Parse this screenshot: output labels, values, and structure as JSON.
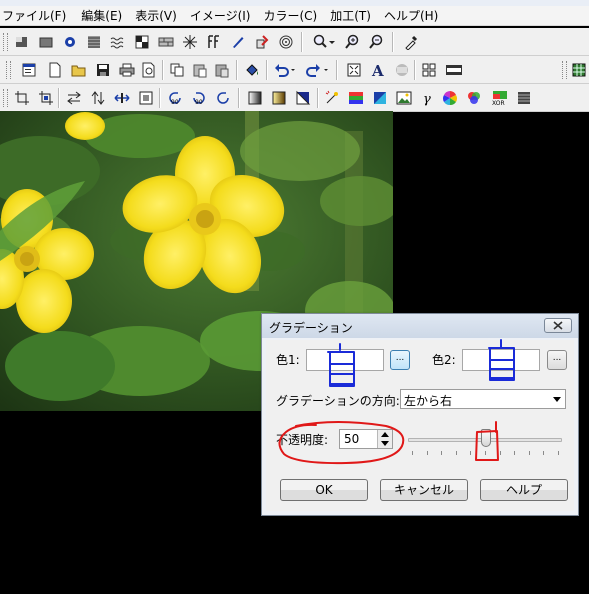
{
  "menu": [
    "ファイル(F)",
    "編集(E)",
    "表示(V)",
    "イメージ(I)",
    "カラー(C)",
    "加工(T)",
    "ヘルプ(H)"
  ],
  "toolbar_icons": {
    "row1": [
      "select-rect-icon",
      "flat-rect-icon",
      "starburst-icon",
      "dither-icon",
      "wave-icon",
      "contrast-icon",
      "brick-icon",
      "explode-icon",
      "ff-icon",
      "pen-icon",
      "brush-icon",
      "spiral-icon",
      "zoom-dropdown-icon",
      "zoom-in-icon",
      "zoom-out-icon",
      "eyedropper-icon"
    ],
    "row2": [
      "new-window-icon",
      "new-file-icon",
      "open-folder-icon",
      "save-icon",
      "print-icon",
      "print-preview-icon",
      "copy-icon",
      "paste-icon",
      "paste-new-icon",
      "paint-bucket-icon",
      "undo-icon",
      "redo-icon",
      "fit-screen-icon",
      "text-icon",
      "align-icon",
      "grid-icon",
      "filmstrip-icon",
      "thumbnail-icon"
    ],
    "row3": [
      "crop-icon",
      "crop-alt-icon",
      "flip-horizontal-icon",
      "flip-vertical-icon",
      "resize-icon",
      "frame-icon",
      "rotate-left-90-icon",
      "rotate-right-90-icon",
      "rotate-free-icon",
      "gradient-gray-icon",
      "gradient-gold-icon",
      "gradient-blue-icon",
      "sparkle-icon",
      "color-balance-icon",
      "color-cube-icon",
      "landscape-icon",
      "gamma-icon",
      "color-wheel-icon",
      "rgb-circles-icon",
      "xor-icon",
      "grayscale-icon"
    ]
  },
  "dialog": {
    "title": "グラデーション",
    "color1_label": "色1:",
    "color2_label": "色2:",
    "browse_label": "...",
    "direction_label": "グラデーションの方向:",
    "direction_value": "左から右",
    "opacity_label": "不透明度:",
    "opacity_value": "50",
    "opacity_slider_fraction": 0.5,
    "ok_label": "OK",
    "cancel_label": "キャンセル",
    "help_label": "ヘルプ"
  },
  "colors": {
    "annotation_blue": "#1a2bd8",
    "annotation_red": "#e01818",
    "flower_yellow": "#f4dc1c"
  }
}
